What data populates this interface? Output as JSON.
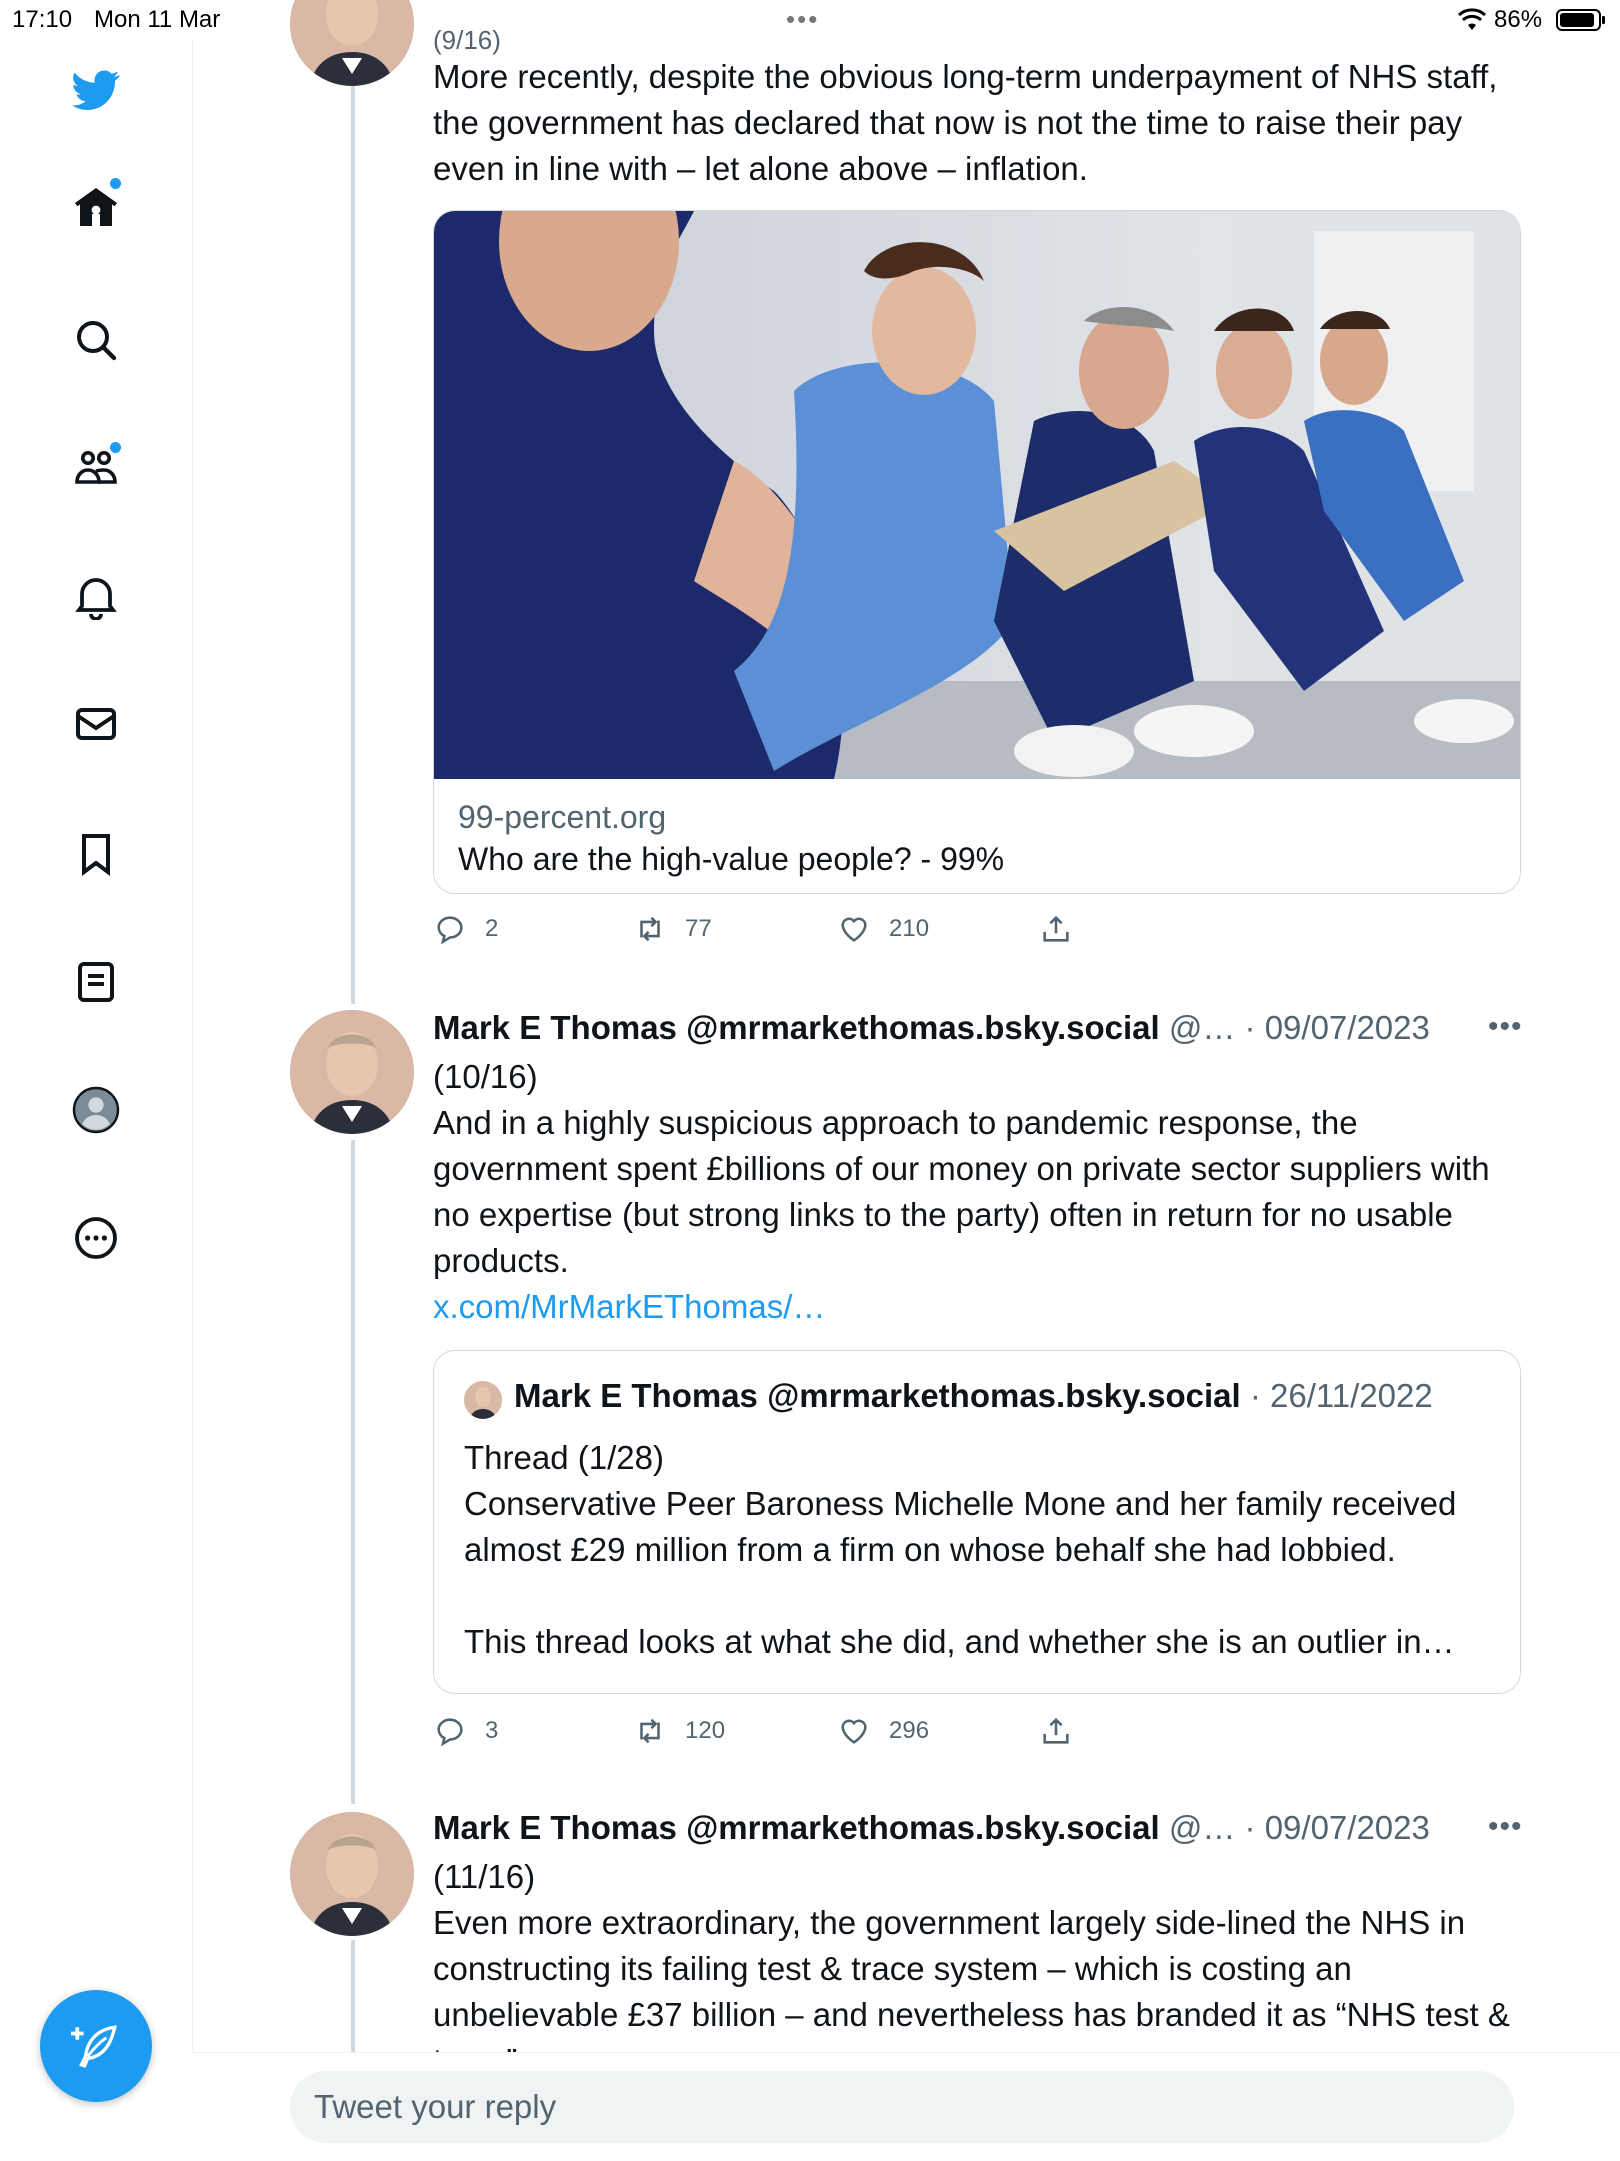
{
  "status_bar": {
    "time": "17:10",
    "date": "Mon 11 Mar",
    "battery": "86%"
  },
  "sidebar": {
    "items": [
      {
        "name": "twitter-logo",
        "icon": "twitter-bird-icon"
      },
      {
        "name": "home",
        "icon": "home-icon",
        "has_dot": true
      },
      {
        "name": "explore",
        "icon": "search-icon"
      },
      {
        "name": "communities",
        "icon": "communities-icon",
        "has_dot": true
      },
      {
        "name": "notifications",
        "icon": "bell-icon"
      },
      {
        "name": "messages",
        "icon": "mail-icon"
      },
      {
        "name": "bookmarks",
        "icon": "bookmark-icon"
      },
      {
        "name": "lists",
        "icon": "list-icon"
      },
      {
        "name": "profile",
        "icon": "avatar-icon"
      },
      {
        "name": "more",
        "icon": "more-circle-icon"
      }
    ],
    "compose_icon": "feather-plus-icon"
  },
  "tweets": [
    {
      "partial_header": "(9/16)",
      "text": "More recently, despite the obvious long-term underpayment of NHS staff, the government has declared that now is not the time to raise their pay even in line with – let alone above – inflation.",
      "card": {
        "domain": "99-percent.org",
        "title": "Who are the high-value people? - 99%"
      },
      "replies": "2",
      "retweets": "77",
      "likes": "210"
    },
    {
      "name": "Mark E Thomas @mrmarkethomas.bsky.social",
      "handle_meta": "@… · 09/07/2023",
      "counter": "(10/16)",
      "text": "And in a highly suspicious approach to pandemic response, the government spent £billions of our money on private sector suppliers with no expertise (but strong links to the party) often in return for no usable products.",
      "link": "x.com/MrMarkEThomas/…",
      "quote": {
        "name": "Mark E Thomas @mrmarkethomas.bsky.social",
        "date": "· 26/11/2022",
        "body": "Thread (1/28)\nConservative Peer Baroness Michelle Mone and her family received almost £29 million from a firm on whose behalf she had lobbied.\n\nThis thread looks at what she did, and whether she is an outlier in…"
      },
      "replies": "3",
      "retweets": "120",
      "likes": "296"
    },
    {
      "name": "Mark E Thomas @mrmarkethomas.bsky.social",
      "handle_meta": "@… · 09/07/2023",
      "counter": "(11/16)",
      "text": "Even more extraordinary, the government largely side-lined the NHS in constructing its failing test & trace system – which is costing an unbelievable £37 billion – and nevertheless has branded it as “NHS test & trace”."
    }
  ],
  "reply_bar": {
    "placeholder": "Tweet your reply"
  },
  "colors": {
    "accent": "#1d9bf0",
    "text": "#0f1419",
    "muted": "#536471",
    "border": "#cfd9de"
  }
}
